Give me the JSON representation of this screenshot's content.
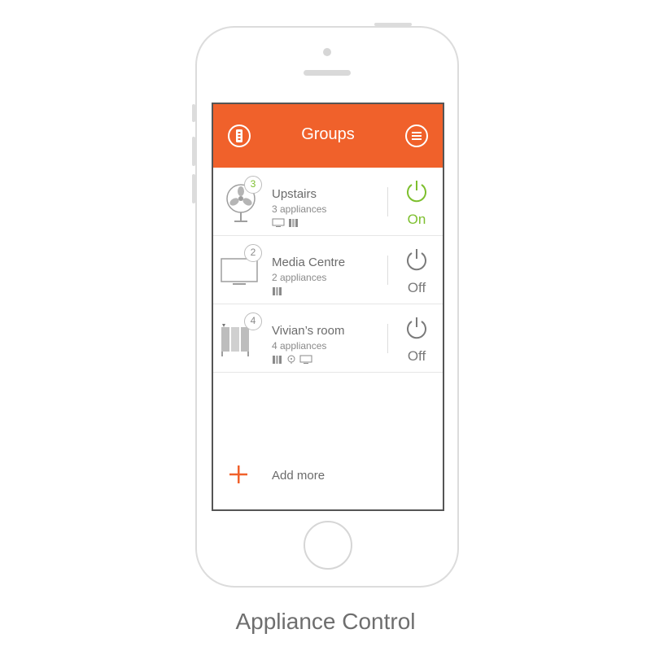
{
  "header": {
    "title": "Groups",
    "left_icon": "remote-icon",
    "right_icon": "menu-icon"
  },
  "groups": [
    {
      "name": "Upstairs",
      "count": "3",
      "subtitle": "3 appliances",
      "icon": "fan-icon",
      "appliances": [
        "tv-icon",
        "heater-icon"
      ],
      "state": "On"
    },
    {
      "name": "Media Centre",
      "count": "2",
      "subtitle": "2 appliances",
      "icon": "tv-icon",
      "appliances": [
        "heater-icon"
      ],
      "state": "Off"
    },
    {
      "name": "Vivian’s room",
      "count": "4",
      "subtitle": "4 appliances",
      "icon": "heater-icon",
      "appliances": [
        "heater-icon",
        "fan-icon",
        "tv-icon"
      ],
      "state": "Off"
    }
  ],
  "add_more": {
    "label": "Add more"
  },
  "caption": "Appliance Control",
  "colors": {
    "accent": "#f0612b",
    "on": "#7dbf2e",
    "off": "#7a7a7a"
  }
}
